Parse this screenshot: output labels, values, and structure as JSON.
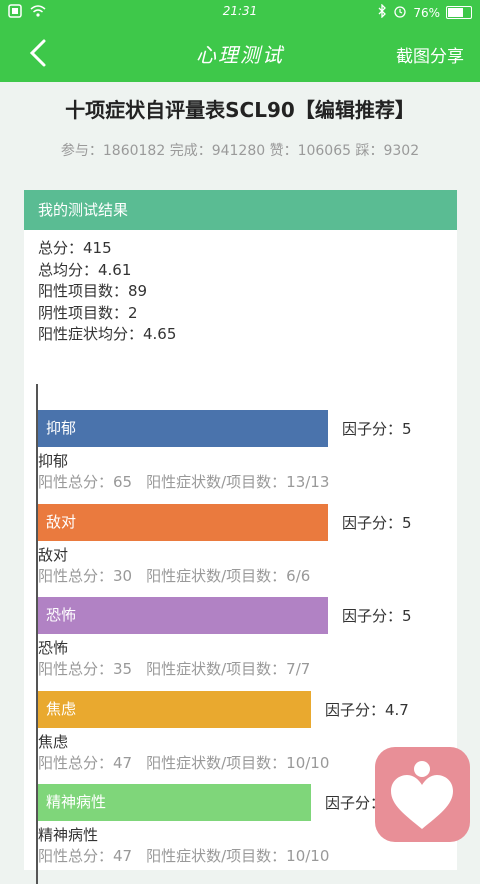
{
  "status_bar": {
    "time": "21:31",
    "battery": "76%",
    "battery_level": 0.76
  },
  "top_bar": {
    "title": "心理测试",
    "share_label": "截图分享"
  },
  "page": {
    "heading": "十项症状自评量表SCL90【编辑推荐】",
    "stats_text": "参与：1860182 完成：941280 赞：106065 踩：9302"
  },
  "result": {
    "header": "我的测试结果",
    "summary": [
      "总分：415",
      "总均分：4.61",
      "阳性项目数：89",
      "阴性项目数：2",
      "阳性症状均分：4.65"
    ],
    "factors": [
      {
        "name": "抑郁",
        "score_text": "因子分：5",
        "score": 5,
        "positive_total": "阳性总分：65",
        "ratio": "阳性症状数/项目数：13/13",
        "color": "#4a73ac"
      },
      {
        "name": "敌对",
        "score_text": "因子分：5",
        "score": 5,
        "positive_total": "阳性总分：30",
        "ratio": "阳性症状数/项目数：6/6",
        "color": "#ea7a3e"
      },
      {
        "name": "恐怖",
        "score_text": "因子分：5",
        "score": 5,
        "positive_total": "阳性总分：35",
        "ratio": "阳性症状数/项目数：7/7",
        "color": "#b182c4"
      },
      {
        "name": "焦虑",
        "score_text": "因子分：4.7",
        "score": 4.7,
        "positive_total": "阳性总分：47",
        "ratio": "阳性症状数/项目数：10/10",
        "color": "#e9a92f"
      },
      {
        "name": "精神病性",
        "score_text": "因子分：4.7",
        "score": 4.7,
        "positive_total": "阳性总分：47",
        "ratio": "阳性症状数/项目数：10/10",
        "color": "#7fd67a"
      }
    ]
  },
  "icons": {
    "back": "chevron-left-icon",
    "float_app": "heart-person-icon"
  }
}
